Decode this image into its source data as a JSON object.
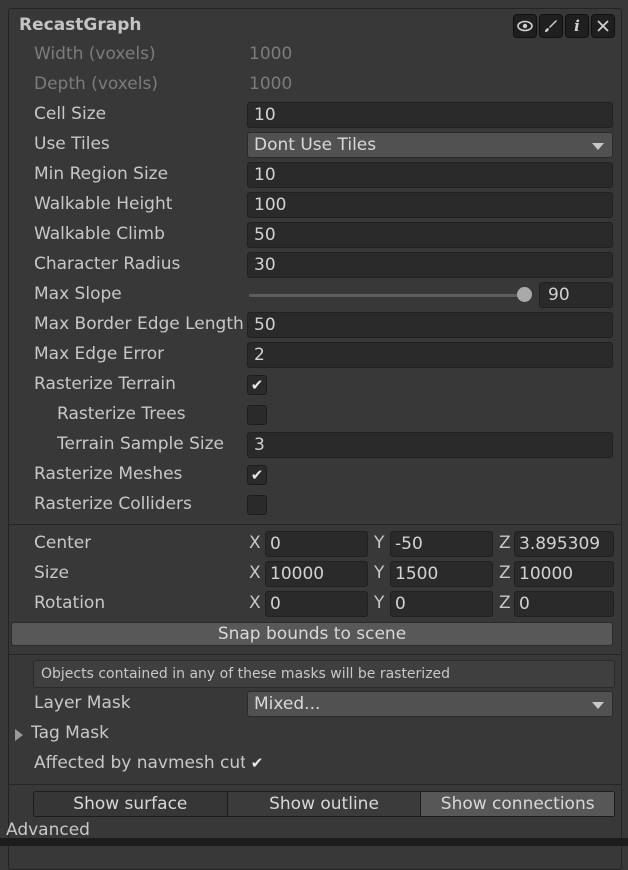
{
  "component": {
    "title": "RecastGraph",
    "icons": [
      "eye-icon",
      "brush-icon",
      "info-icon",
      "close-icon"
    ]
  },
  "fields": {
    "width_label": "Width (voxels)",
    "width_value": "1000",
    "depth_label": "Depth (voxels)",
    "depth_value": "1000",
    "cell_size_label": "Cell Size",
    "cell_size_value": "10",
    "use_tiles_label": "Use Tiles",
    "use_tiles_value": "Dont Use Tiles",
    "min_region_label": "Min Region Size",
    "min_region_value": "10",
    "walk_height_label": "Walkable Height",
    "walk_height_value": "100",
    "walk_climb_label": "Walkable Climb",
    "walk_climb_value": "50",
    "char_radius_label": "Character Radius",
    "char_radius_value": "30",
    "max_slope_label": "Max Slope",
    "max_slope_value": "90",
    "max_border_label": "Max Border Edge Length",
    "max_border_value": "50",
    "max_edge_error_label": "Max Edge Error",
    "max_edge_error_value": "2",
    "rast_terrain_label": "Rasterize Terrain",
    "rast_trees_label": "Rasterize Trees",
    "terrain_sample_label": "Terrain Sample Size",
    "terrain_sample_value": "3",
    "rast_meshes_label": "Rasterize Meshes",
    "rast_colliders_label": "Rasterize Colliders"
  },
  "bounds": {
    "axes": [
      "X",
      "Y",
      "Z"
    ],
    "center_label": "Center",
    "center": [
      "0",
      "-50",
      "3.895309"
    ],
    "size_label": "Size",
    "size": [
      "10000",
      "1500",
      "10000"
    ],
    "rotation_label": "Rotation",
    "rotation": [
      "0",
      "0",
      "0"
    ],
    "snap_button": "Snap bounds to scene"
  },
  "masks": {
    "help_text": "Objects contained in any of these masks will be rasterized",
    "layer_mask_label": "Layer Mask",
    "layer_mask_value": "Mixed...",
    "tag_mask_label": "Tag Mask",
    "navmesh_cut_label": "Affected by navmesh cuts"
  },
  "display": {
    "show_surface": "Show surface",
    "show_outline": "Show outline",
    "show_connections": "Show connections"
  },
  "advanced_label": "Advanced",
  "checkmark": "✔"
}
